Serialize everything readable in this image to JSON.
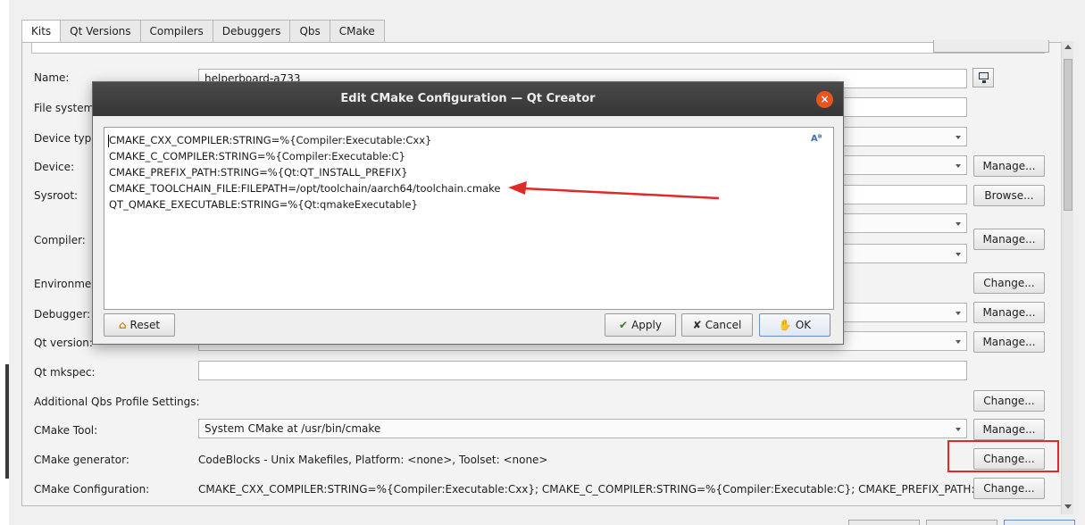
{
  "tabs": [
    {
      "label": "Kits"
    },
    {
      "label": "Qt Versions"
    },
    {
      "label": "Compilers"
    },
    {
      "label": "Debuggers"
    },
    {
      "label": "Qbs"
    },
    {
      "label": "CMake"
    }
  ],
  "form": {
    "name_label": "Name:",
    "name_value": "helperboard-a733",
    "filesystem_label": "File system",
    "devicetype_label": "Device type",
    "device_label": "Device:",
    "sysroot_label": "Sysroot:",
    "compiler_label": "Compiler:",
    "environment_label": "Environmer",
    "debugger_label": "Debugger:",
    "qtversion_label": "Qt version:",
    "qtmkspec_label": "Qt mkspec:",
    "qbs_label": "Additional Qbs Profile Settings:",
    "cmaketool_label": "CMake Tool:",
    "cmaketool_value": "System CMake at /usr/bin/cmake",
    "cmakegen_label": "CMake generator:",
    "cmakegen_value": "CodeBlocks - Unix Makefiles, Platform: <none>, Toolset: <none>",
    "cmakeconf_label": "CMake Configuration:",
    "cmakeconf_value": "CMAKE_CXX_COMPILER:STRING=%{Compiler:Executable:Cxx}; CMAKE_C_COMPILER:STRING=%{Compiler:Executable:C}; CMAKE_PREFIX_PATH:STRIN···"
  },
  "buttons": {
    "manage": "Manage...",
    "browse": "Browse...",
    "change": "Change..."
  },
  "dialog": {
    "title": "Edit CMake Configuration — Qt Creator",
    "close_glyph": "×",
    "lines": [
      "CMAKE_CXX_COMPILER:STRING=%{Compiler:Executable:Cxx}",
      "CMAKE_C_COMPILER:STRING=%{Compiler:Executable:C}",
      "CMAKE_PREFIX_PATH:STRING=%{Qt:QT_INSTALL_PREFIX}",
      "CMAKE_TOOLCHAIN_FILE:FILEPATH=/opt/toolchain/aarch64/toolchain.cmake",
      "QT_QMAKE_EXECUTABLE:STRING=%{Qt:qmakeExecutable}"
    ],
    "reset": "Reset",
    "apply": "Apply",
    "cancel": "Cancel",
    "ok": "OK"
  },
  "colors": {
    "annotation_red": "#e02a2a",
    "title_bar": "#3c3c3c",
    "close_orange": "#e95420"
  },
  "icons": [
    "monitor-icon",
    "dropdown-arrow-icon",
    "spellcheck-icon",
    "broom-icon",
    "check-icon",
    "cross-icon",
    "thumbs-up-icon",
    "close-icon"
  ]
}
